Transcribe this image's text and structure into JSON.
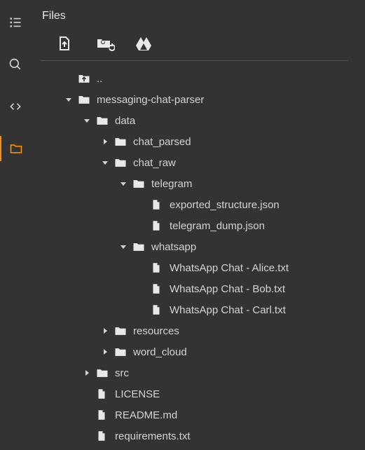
{
  "title": "Files",
  "colors": {
    "accent": "#ff8c00"
  },
  "leftbar": [
    {
      "name": "toc-icon"
    },
    {
      "name": "search-icon"
    },
    {
      "name": "code-icon"
    },
    {
      "name": "folder-icon",
      "active": true
    }
  ],
  "toolbar": [
    {
      "name": "upload-file-button"
    },
    {
      "name": "refresh-folder-button"
    },
    {
      "name": "mount-drive-button"
    }
  ],
  "tree": [
    {
      "depth": 0,
      "type": "up",
      "label": "..",
      "expand": null
    },
    {
      "depth": 0,
      "type": "folder",
      "label": "messaging-chat-parser",
      "expand": "open"
    },
    {
      "depth": 1,
      "type": "folder",
      "label": "data",
      "expand": "open"
    },
    {
      "depth": 2,
      "type": "folder",
      "label": "chat_parsed",
      "expand": "closed"
    },
    {
      "depth": 2,
      "type": "folder",
      "label": "chat_raw",
      "expand": "open"
    },
    {
      "depth": 3,
      "type": "folder",
      "label": "telegram",
      "expand": "open"
    },
    {
      "depth": 4,
      "type": "file",
      "label": "exported_structure.json",
      "expand": null
    },
    {
      "depth": 4,
      "type": "file",
      "label": "telegram_dump.json",
      "expand": null
    },
    {
      "depth": 3,
      "type": "folder",
      "label": "whatsapp",
      "expand": "open"
    },
    {
      "depth": 4,
      "type": "file",
      "label": "WhatsApp Chat - Alice.txt",
      "expand": null
    },
    {
      "depth": 4,
      "type": "file",
      "label": "WhatsApp Chat - Bob.txt",
      "expand": null
    },
    {
      "depth": 4,
      "type": "file",
      "label": "WhatsApp Chat - Carl.txt",
      "expand": null
    },
    {
      "depth": 2,
      "type": "folder",
      "label": "resources",
      "expand": "closed"
    },
    {
      "depth": 2,
      "type": "folder",
      "label": "word_cloud",
      "expand": "closed"
    },
    {
      "depth": 1,
      "type": "folder",
      "label": "src",
      "expand": "closed"
    },
    {
      "depth": 1,
      "type": "file",
      "label": "LICENSE",
      "expand": null
    },
    {
      "depth": 1,
      "type": "file",
      "label": "README.md",
      "expand": null
    },
    {
      "depth": 1,
      "type": "file",
      "label": "requirements.txt",
      "expand": null
    }
  ]
}
